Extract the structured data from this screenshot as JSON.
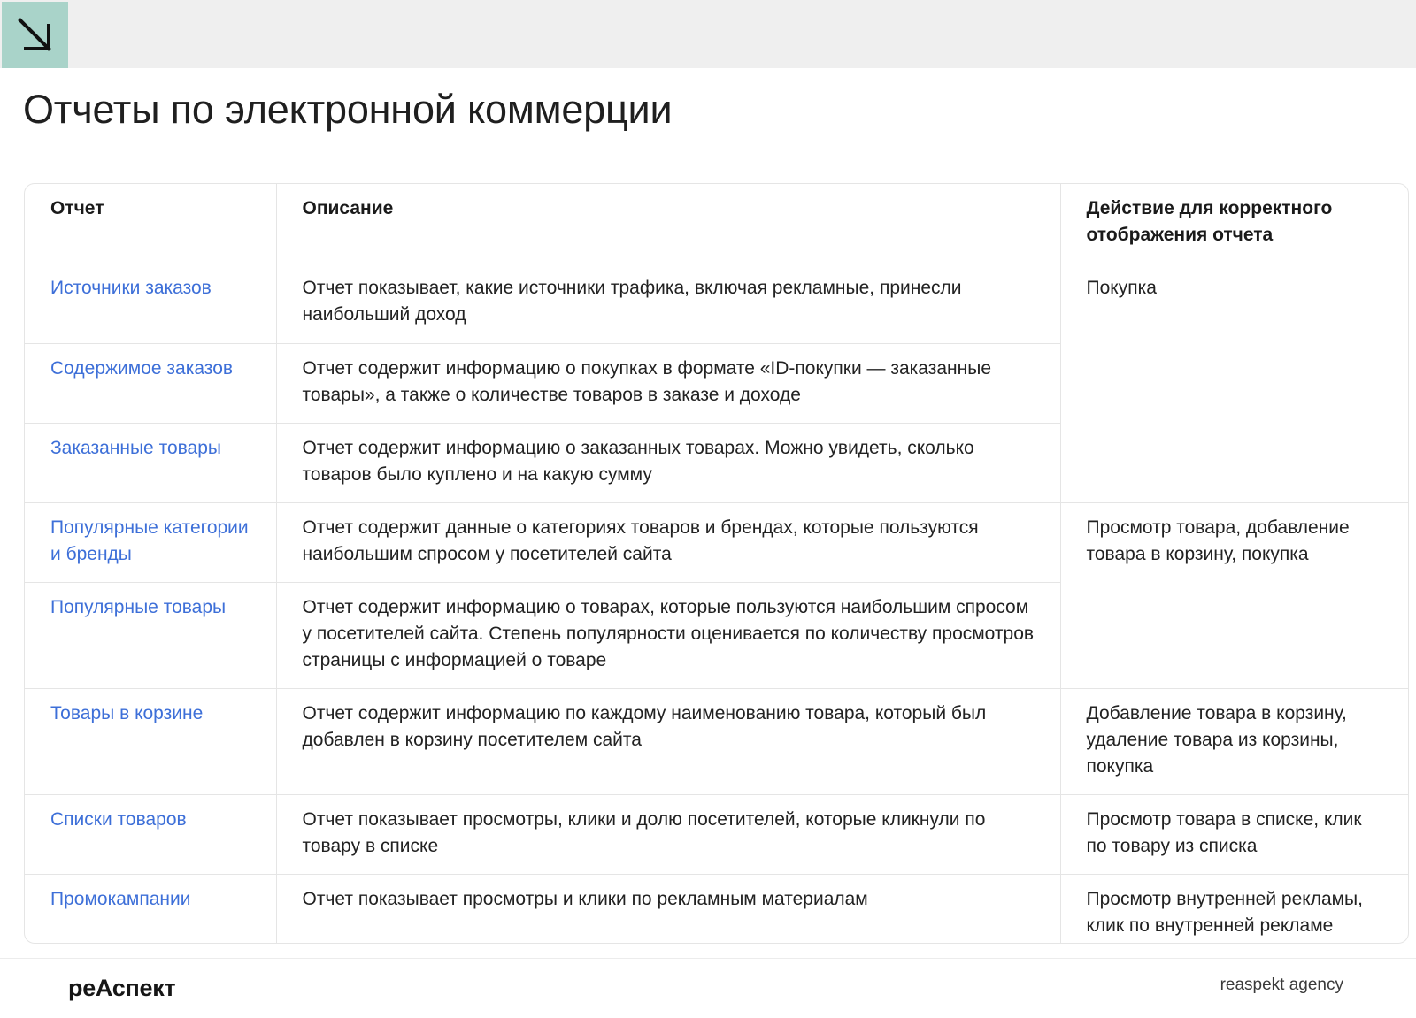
{
  "header": {
    "title": "Отчеты по электронной коммерции",
    "accent_color": "#a9d3c9",
    "icon": "arrow-down-right-icon"
  },
  "table": {
    "columns": [
      "Отчет",
      "Описание",
      "Действие для корректного отображения отчета"
    ],
    "rows": [
      {
        "report": "Источники заказов",
        "description": "Отчет показывает, какие источники трафика, включая рекламные, принесли наибольший доход"
      },
      {
        "report": "Содержимое заказов",
        "description": "Отчет содержит информацию о покупках в формате «ID-покупки — заказанные товары», а также о количестве товаров в заказе и доходе"
      },
      {
        "report": "Заказанные товары",
        "description": "Отчет содержит информацию о заказанных товарах. Можно увидеть, сколько товаров было куплено и на какую сумму"
      },
      {
        "report": "Популярные категории и бренды",
        "description": "Отчет содержит данные о категориях товаров и брендах, которые пользуются наибольшим спросом у посетителей сайта"
      },
      {
        "report": "Популярные товары",
        "description": "Отчет содержит информацию о товарах, которые пользуются наибольшим спросом у посетителей сайта. Степень популярности оценивается по количеству просмотров страницы с информацией о товаре"
      },
      {
        "report": "Товары в корзине",
        "description": "Отчет содержит информацию по каждому наименованию товара, который был добавлен в корзину посетителем сайта"
      },
      {
        "report": "Списки товаров",
        "description": "Отчет показывает просмотры, клики и долю посетителей, которые кликнули по товару в списке"
      },
      {
        "report": "Промокампании",
        "description": "Отчет показывает просмотры и клики по рекламным материалам"
      }
    ],
    "actions": [
      "Покупка",
      "Просмотр товара, добавление товара в корзину, покупка",
      "Добавление товара в корзину, удаление товара из корзины, покупка",
      "Просмотр товара в списке, клик по товару из списка",
      "Просмотр внутренней рекламы, клик по внутренней рекламе"
    ],
    "link_color": "#3d6fd8"
  },
  "footer": {
    "logo": "реАспект",
    "agency": "reaspekt agency"
  }
}
